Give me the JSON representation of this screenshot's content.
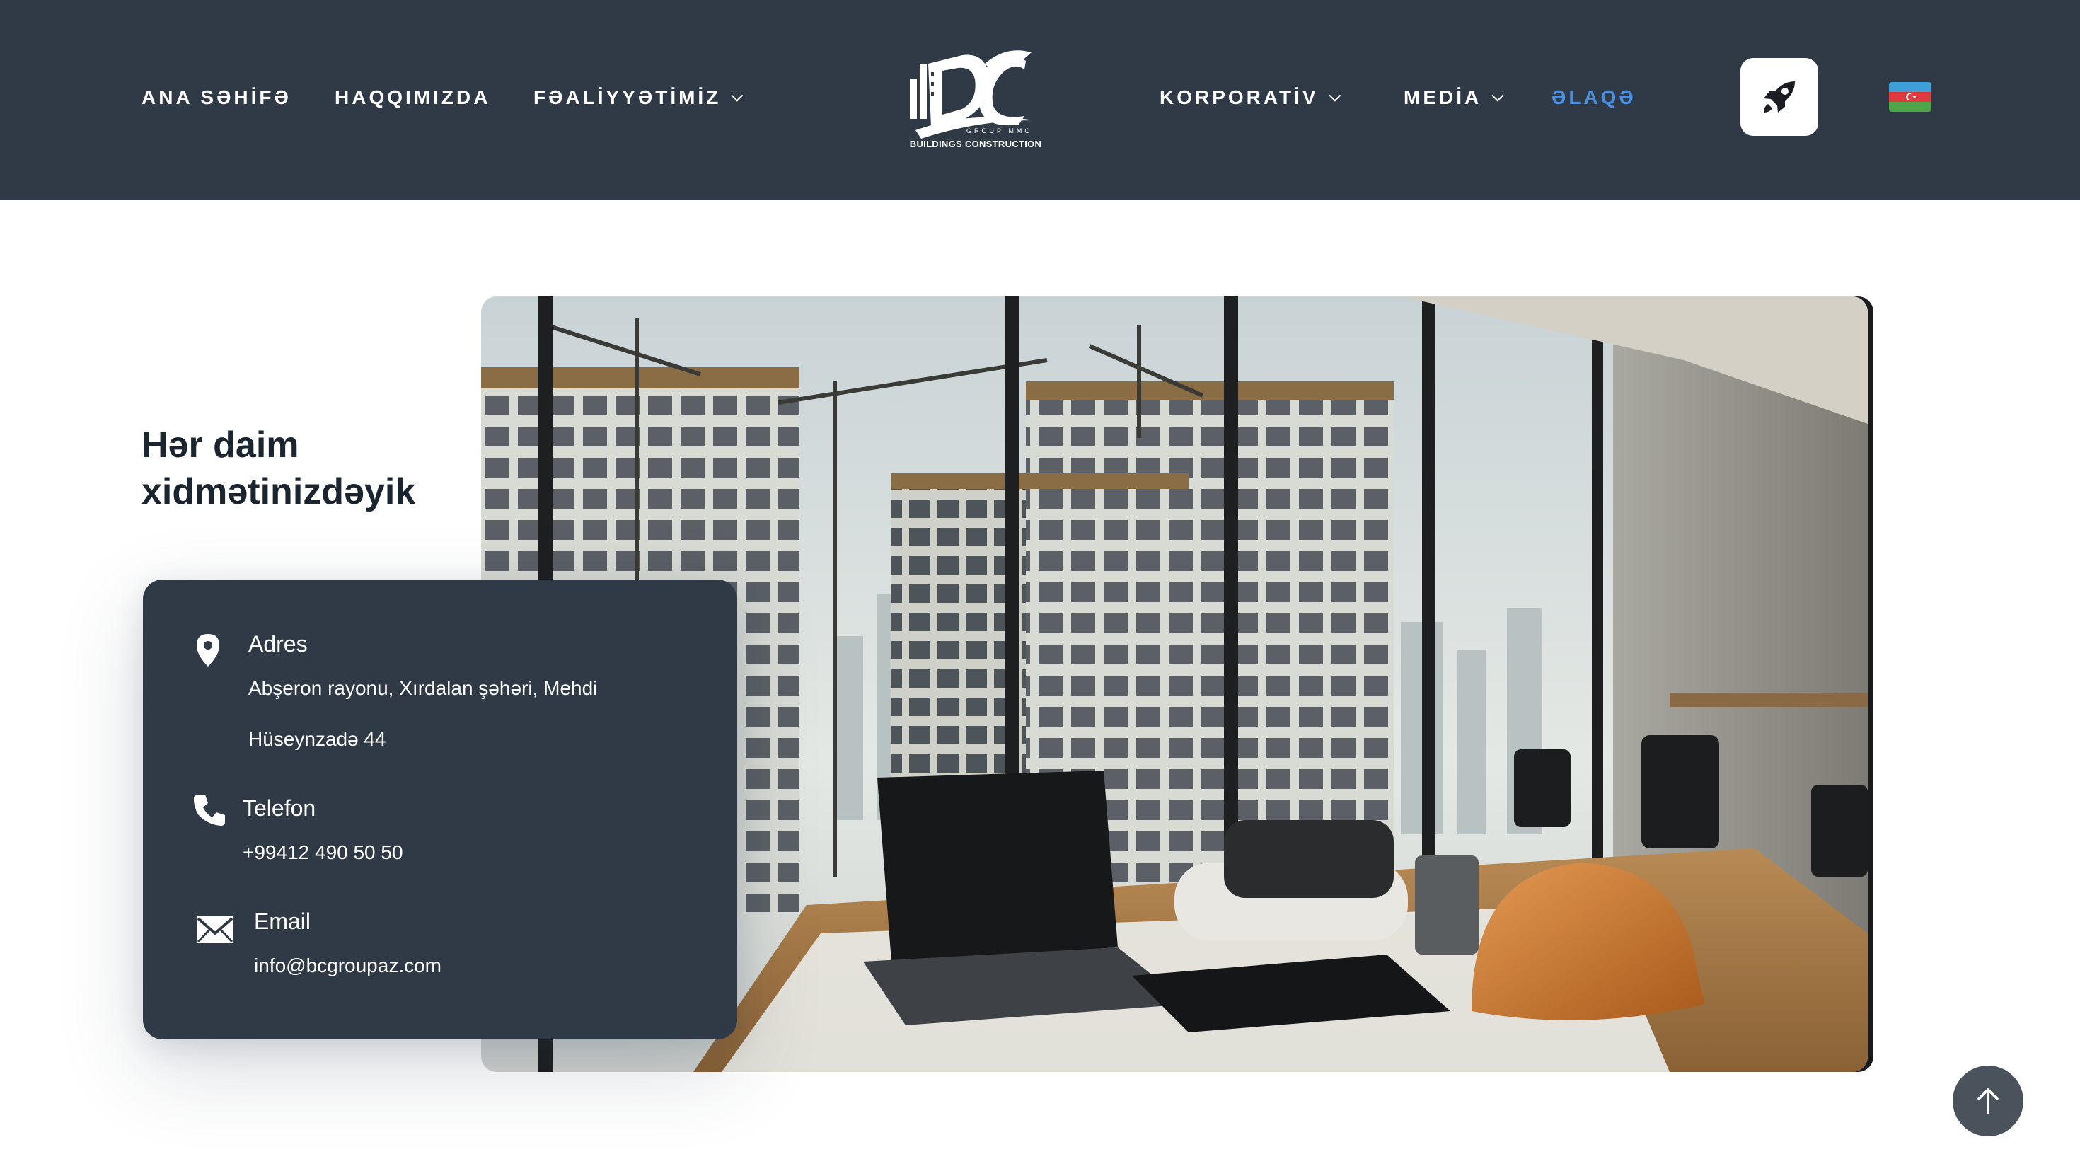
{
  "nav": {
    "left": [
      {
        "label": "ANA SƏHİFƏ",
        "dropdown": false
      },
      {
        "label": "HAQQIMIZDA",
        "dropdown": false
      },
      {
        "label": "FƏALİYYƏTİMİZ",
        "dropdown": true
      }
    ],
    "right": [
      {
        "label": "KORPORATİV",
        "dropdown": true
      },
      {
        "label": "MEDİA",
        "dropdown": true
      },
      {
        "label": "ƏLAQƏ",
        "dropdown": false,
        "active": true
      }
    ]
  },
  "logo": {
    "sub": "GROUP MMC",
    "text": "BUILDINGS CONSTRUCTION"
  },
  "colors": {
    "header_bg": "#2f3a46",
    "active_link": "#4a90e2",
    "card_bg": "#2f3a46"
  },
  "icons": {
    "cta": "rocket-icon",
    "language": "azerbaijan-flag-icon",
    "address": "map-pin-icon",
    "phone": "phone-icon",
    "email": "envelope-icon",
    "back_to_top": "arrow-up-icon"
  },
  "main": {
    "heading": "Hər daim xidmətinizdəyik"
  },
  "contact": {
    "address_title": "Adres",
    "address_line1": "Abşeron rayonu, Xırdalan şəhəri, Mehdi",
    "address_line2": "Hüseynzadə 44",
    "phone_title": "Telefon",
    "phone_value": "+99412 490 50 50",
    "email_title": "Email",
    "email_value": "info@bcgroupaz.com"
  }
}
